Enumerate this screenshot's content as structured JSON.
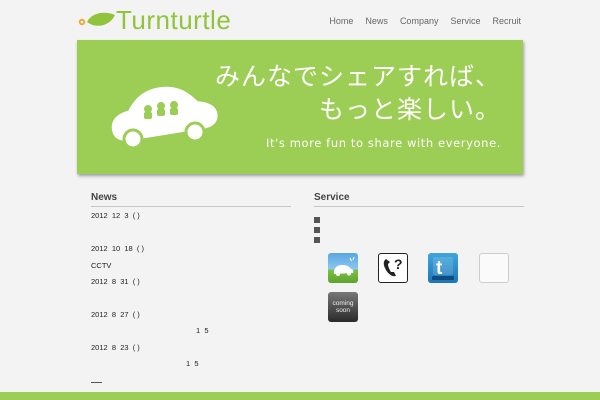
{
  "site": {
    "logo_text": "Turnturtle",
    "brand_color": "#8fc43c"
  },
  "nav": {
    "items": [
      "Home",
      "News",
      "Company",
      "Service",
      "Recruit"
    ]
  },
  "hero": {
    "jp_line1": "みんなでシェアすれば、",
    "jp_line2": "もっと楽しい。",
    "en_line": "It's more fun to share with everyone.",
    "bg_color": "#9ccd54",
    "icon": "car-icon"
  },
  "news": {
    "title": "News",
    "items": [
      "2012  12  3  ( )",
      "2012  10  18  ( )",
      "CCTV",
      "2012  8  31  ( )",
      "2012  8  27  ( )",
      "1  5",
      "2012  8  23  ( )",
      "1  5"
    ]
  },
  "service": {
    "title": "Service",
    "icons": [
      "car-share-app-icon",
      "phone-help-icon",
      "twitter-icon",
      "blank-app-icon",
      "coming-soon-icon"
    ],
    "coming_soon_line1": "coming",
    "coming_soon_line2": "soon"
  }
}
